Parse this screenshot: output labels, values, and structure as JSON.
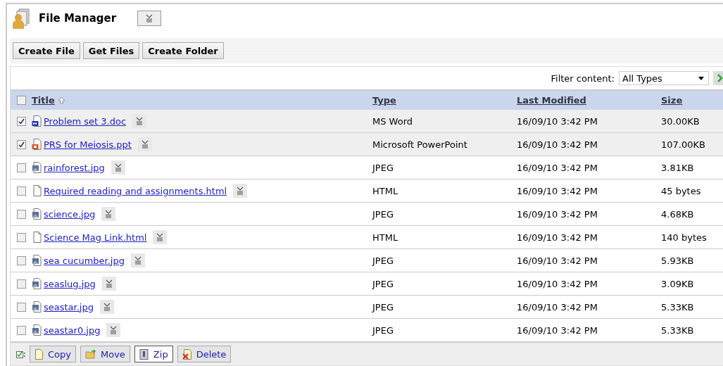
{
  "header": {
    "title": "File Manager"
  },
  "toolbar": {
    "buttons": [
      "Create File",
      "Get Files",
      "Create Folder"
    ]
  },
  "filter": {
    "label": "Filter content:",
    "value": "All Types"
  },
  "table": {
    "columns": [
      {
        "label": "Title",
        "sorted": true
      },
      {
        "label": "Type",
        "sorted": false
      },
      {
        "label": "Last Modified",
        "sorted": false
      },
      {
        "label": "Size",
        "sorted": false
      }
    ],
    "header_checked": false,
    "rows": [
      {
        "name": "Problem set 3.doc",
        "kind": "doc",
        "type": "MS Word",
        "modified": "16/09/10 3:42 PM",
        "size": "30.00KB",
        "checked": true
      },
      {
        "name": "PRS for Meiosis.ppt",
        "kind": "ppt",
        "type": "Microsoft PowerPoint",
        "modified": "16/09/10 3:42 PM",
        "size": "107.00KB",
        "checked": true
      },
      {
        "name": "rainforest.jpg",
        "kind": "image",
        "type": "JPEG",
        "modified": "16/09/10 3:42 PM",
        "size": "3.81KB",
        "checked": false
      },
      {
        "name": "Required reading and assignments.html",
        "kind": "html",
        "type": "HTML",
        "modified": "16/09/10 3:42 PM",
        "size": "45 bytes",
        "checked": false
      },
      {
        "name": "science.jpg",
        "kind": "image",
        "type": "JPEG",
        "modified": "16/09/10 3:42 PM",
        "size": "4.68KB",
        "checked": false
      },
      {
        "name": "Science Mag Link.html",
        "kind": "html",
        "type": "HTML",
        "modified": "16/09/10 3:42 PM",
        "size": "140 bytes",
        "checked": false
      },
      {
        "name": "sea cucumber.jpg",
        "kind": "image",
        "type": "JPEG",
        "modified": "16/09/10 3:42 PM",
        "size": "5.93KB",
        "checked": false
      },
      {
        "name": "seaslug.jpg",
        "kind": "image",
        "type": "JPEG",
        "modified": "16/09/10 3:42 PM",
        "size": "3.09KB",
        "checked": false
      },
      {
        "name": "seastar.jpg",
        "kind": "image",
        "type": "JPEG",
        "modified": "16/09/10 3:42 PM",
        "size": "5.33KB",
        "checked": false
      },
      {
        "name": "seastar0.jpg",
        "kind": "image",
        "type": "JPEG",
        "modified": "16/09/10 3:42 PM",
        "size": "5.33KB",
        "checked": false
      }
    ]
  },
  "actions": [
    {
      "label": "Copy",
      "kind": "copy",
      "selected": false
    },
    {
      "label": "Move",
      "kind": "move",
      "selected": false
    },
    {
      "label": "Zip",
      "kind": "zip",
      "selected": true
    },
    {
      "label": "Delete",
      "kind": "delete",
      "selected": false
    }
  ]
}
